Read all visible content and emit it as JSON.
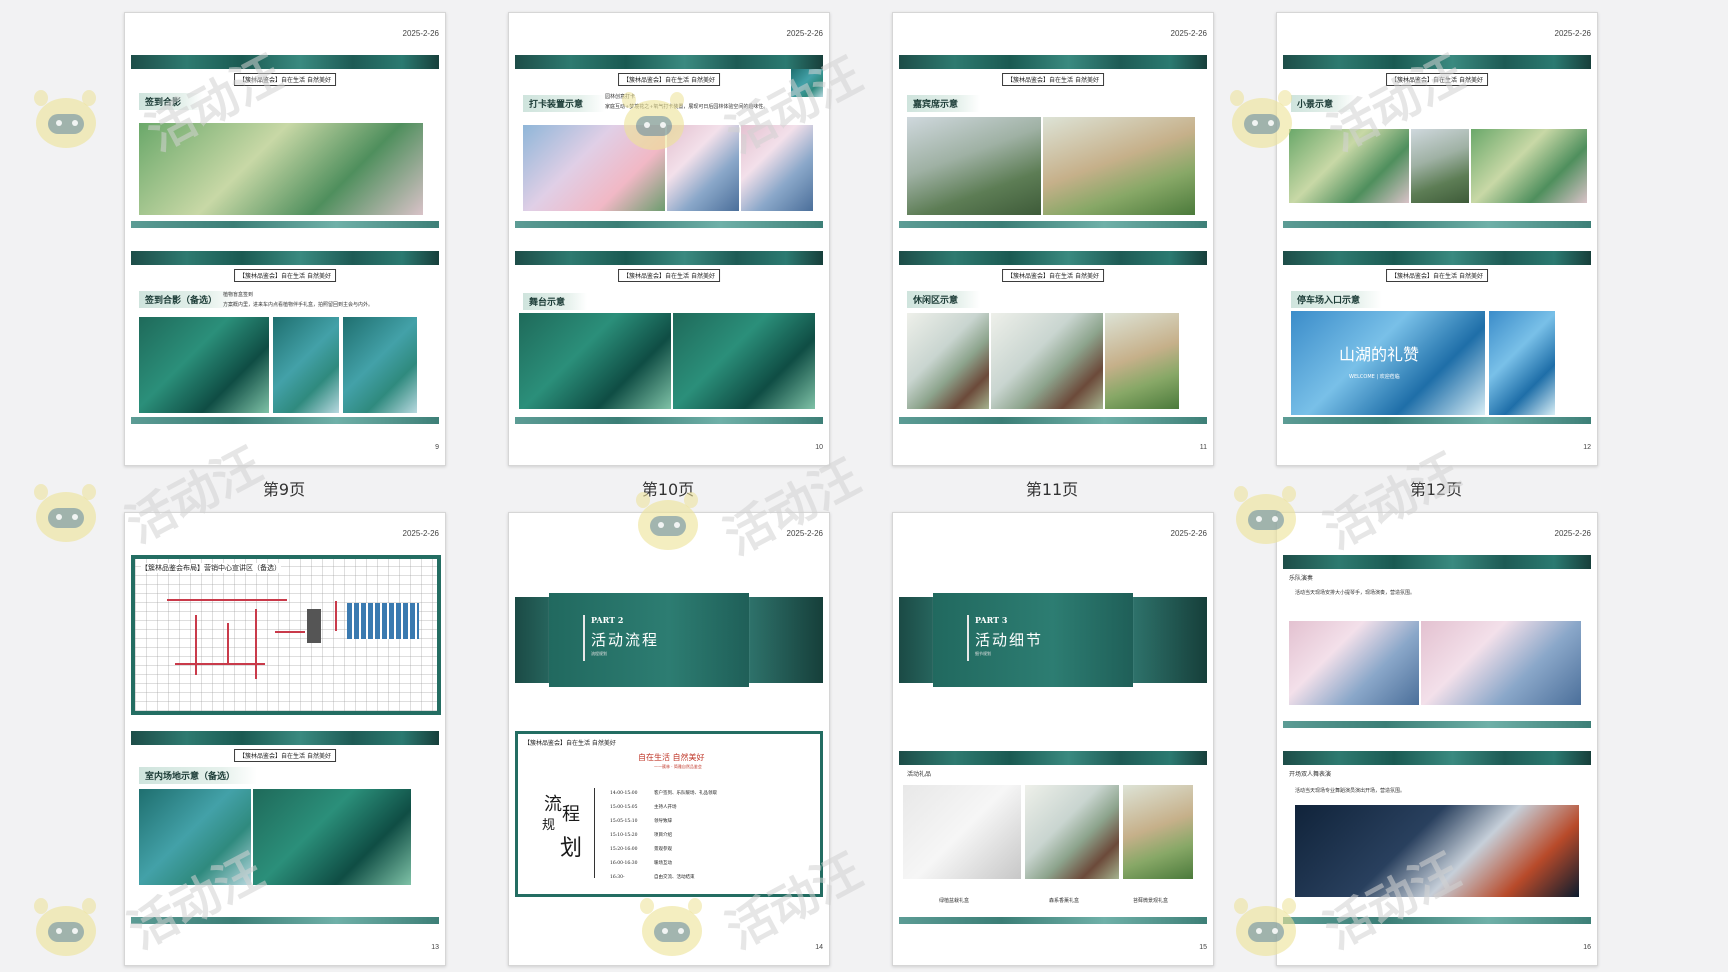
{
  "thumbnails": [
    {
      "page": "9",
      "caption": "第9页",
      "date": "2025-2-26",
      "top_banner": "【簇林品鉴会】自在生活 自然美好",
      "top_tag": "签到合影",
      "bottom_banner": "【簇林品鉴会】自在生活 自然美好",
      "bottom_tag": "签到合影（备选）",
      "bottom_note1": "植物盲盒签到",
      "bottom_note2": "方案概内里，进来车内点看植物伴手礼盒，拍照留回到主会与内外。"
    },
    {
      "page": "10",
      "caption": "第10页",
      "date": "2025-2-26",
      "top_banner": "【簇林品鉴会】自在生活 自然美好",
      "top_tag": "打卡装置示意",
      "top_note1": "园林创意打卡",
      "top_note2": "家庭互动+梦境花之+氧气打卡装置，展现可日后园林体验空间的趣味性。",
      "bottom_banner": "【簇林品鉴会】自在生活 自然美好",
      "bottom_tag": "舞台示意"
    },
    {
      "page": "11",
      "caption": "第11页",
      "date": "2025-2-26",
      "top_banner": "【簇林品鉴会】自在生活 自然美好",
      "top_tag": "嘉宾席示意",
      "bottom_banner": "【簇林品鉴会】自在生活 自然美好",
      "bottom_tag": "休闲区示意"
    },
    {
      "page": "12",
      "caption": "第12页",
      "date": "2025-2-26",
      "top_banner": "【簇林品鉴会】自在生活 自然美好",
      "top_tag": "小景示意",
      "bottom_banner": "【簇林品鉴会】自在生活 自然美好",
      "bottom_tag": "停车场入口示意",
      "photo_text": "山湖的礼赞",
      "photo_sub": "WELCOME | 欢迎莅临"
    },
    {
      "page": "13",
      "date": "2025-2-26",
      "plan_title": "【簇林品鉴会布局】营销中心宣讲区（备选）",
      "bottom_banner": "【簇林品鉴会】自在生活 自然美好",
      "bottom_tag": "室内场地示意（备选）"
    },
    {
      "page": "14",
      "date": "2025-2-26",
      "part": "PART 2",
      "title": "活动流程",
      "subtitle": "流程规划",
      "flow_head": "【簇林品鉴会】自在生活 自然美好",
      "flow_red": "自在生活 自然美好",
      "flow_red_sub": "——簇林 · 简雅自然品鉴会",
      "big1": "流",
      "big2": "程",
      "big3": "规",
      "big4": "划",
      "schedule": [
        {
          "time": "14:00-15:00",
          "item": "客户签到、乐队暖场、礼品领取"
        },
        {
          "time": "15:00-15:05",
          "item": "主持人开场"
        },
        {
          "time": "15:05-15:10",
          "item": "领导致辞"
        },
        {
          "time": "15:10-15:20",
          "item": "项目介绍"
        },
        {
          "time": "15:20-16:00",
          "item": "景观参观"
        },
        {
          "time": "16:00-16:30",
          "item": "暖场互动"
        },
        {
          "time": "16:30-",
          "item": "自由交流、活动结束"
        }
      ]
    },
    {
      "page": "15",
      "date": "2025-2-26",
      "part": "PART 3",
      "title": "活动细节",
      "subtitle": "细节规划",
      "section": "活动礼品",
      "gift1": "绿植盆栽礼盒",
      "gift2": "森系香薰礼盒",
      "gift3": "苔藓微景观礼盒"
    },
    {
      "page": "16",
      "date": "2025-2-26",
      "section1": "乐队演奏",
      "note1": "活动当天现场安排大小提琴手，现场演奏，营造氛围。",
      "section2": "开场双人舞表演",
      "note2": "活动当天现场专业舞蹈演员演出开场，营造氛围。"
    }
  ],
  "watermark": "活动汪"
}
